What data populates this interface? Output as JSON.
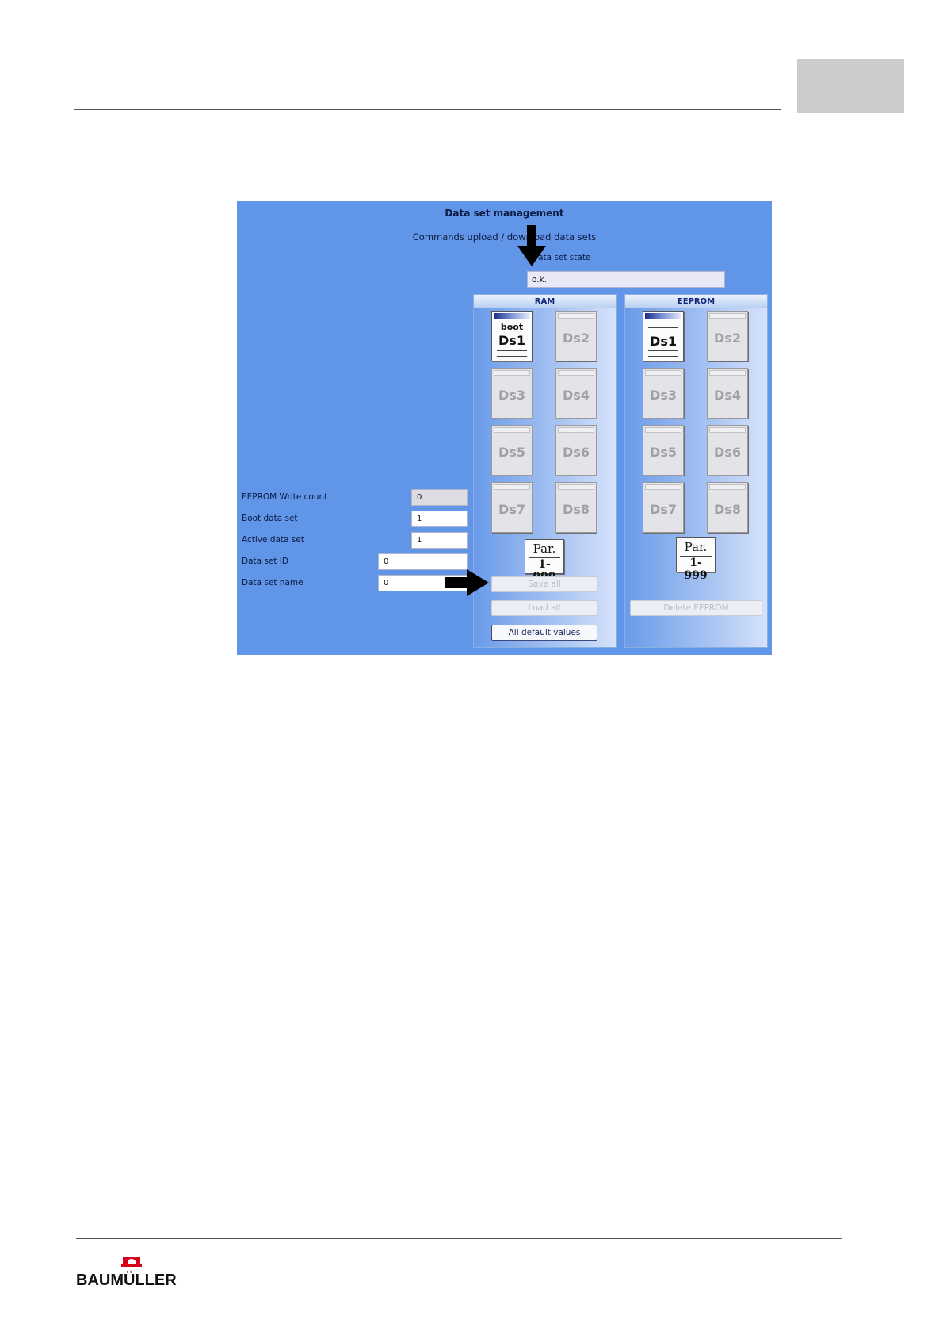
{
  "dialog": {
    "title": "Data set management",
    "subtitle": "Commands upload / download data sets",
    "state_label": "Data set state",
    "state_value": "o.k."
  },
  "ram": {
    "header": "RAM",
    "boot_tag": "boot",
    "datasets": [
      "Ds1",
      "Ds2",
      "Ds3",
      "Ds4",
      "Ds5",
      "Ds6",
      "Ds7",
      "Ds8"
    ],
    "active": "Ds1",
    "par_line1": "Par.",
    "par_line2": "1-999",
    "save_all": "Save all",
    "load_all": "Load all",
    "default_values": "All default values"
  },
  "eeprom": {
    "header": "EEPROM",
    "datasets": [
      "Ds1",
      "Ds2",
      "Ds3",
      "Ds4",
      "Ds5",
      "Ds6",
      "Ds7",
      "Ds8"
    ],
    "active": "Ds1",
    "par_line1": "Par.",
    "par_line2": "1-999",
    "delete": "Delete EEPROM"
  },
  "fields": {
    "eeprom_write_count": {
      "label": "EEPROM Write count",
      "value": "0"
    },
    "boot_data_set": {
      "label": "Boot data set",
      "value": "1"
    },
    "active_data_set": {
      "label": "Active data set",
      "value": "1"
    },
    "data_set_id": {
      "label": "Data set ID",
      "value": "0"
    },
    "data_set_name": {
      "label": "Data set name",
      "value": "0"
    }
  },
  "footer": {
    "logo_text": "BAUMÜLLER"
  },
  "colors": {
    "panel_bg": "#6195e8",
    "logo_red": "#d8001a"
  }
}
